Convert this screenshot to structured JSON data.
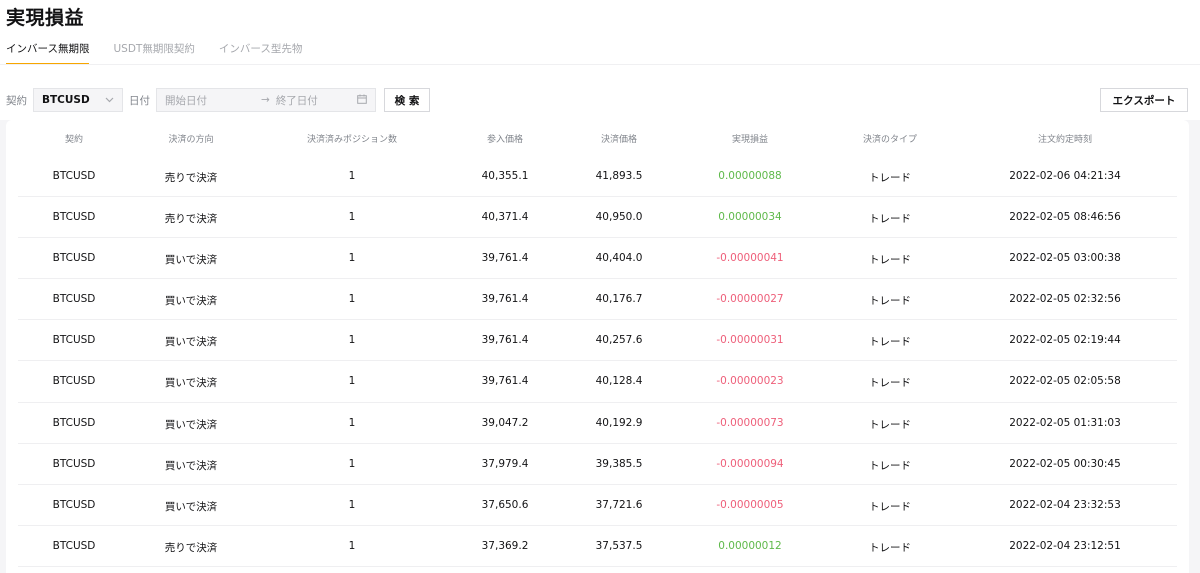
{
  "page": {
    "title": "実現損益"
  },
  "tabs": [
    {
      "label": "インバース無期限",
      "active": true
    },
    {
      "label": "USDT無期限契約",
      "active": false
    },
    {
      "label": "インバース型先物",
      "active": false
    }
  ],
  "filters": {
    "contract_label": "契約",
    "contract_value": "BTCUSD",
    "date_label": "日付",
    "start_placeholder": "開始日付",
    "end_placeholder": "終了日付",
    "search_label": "検 索",
    "export_label": "エクスポート"
  },
  "table": {
    "headers": [
      "契約",
      "決済の方向",
      "決済済みポジション数",
      "参入価格",
      "決済価格",
      "実現損益",
      "決済のタイプ",
      "注文約定時刻"
    ],
    "rows": [
      {
        "contract": "BTCUSD",
        "side": "売りで決済",
        "qty": "1",
        "entry": "40,355.1",
        "exit": "41,893.5",
        "pnl": "0.00000088",
        "type": "トレード",
        "time": "2022-02-06 04:21:34"
      },
      {
        "contract": "BTCUSD",
        "side": "売りで決済",
        "qty": "1",
        "entry": "40,371.4",
        "exit": "40,950.0",
        "pnl": "0.00000034",
        "type": "トレード",
        "time": "2022-02-05 08:46:56"
      },
      {
        "contract": "BTCUSD",
        "side": "買いで決済",
        "qty": "1",
        "entry": "39,761.4",
        "exit": "40,404.0",
        "pnl": "-0.00000041",
        "type": "トレード",
        "time": "2022-02-05 03:00:38"
      },
      {
        "contract": "BTCUSD",
        "side": "買いで決済",
        "qty": "1",
        "entry": "39,761.4",
        "exit": "40,176.7",
        "pnl": "-0.00000027",
        "type": "トレード",
        "time": "2022-02-05 02:32:56"
      },
      {
        "contract": "BTCUSD",
        "side": "買いで決済",
        "qty": "1",
        "entry": "39,761.4",
        "exit": "40,257.6",
        "pnl": "-0.00000031",
        "type": "トレード",
        "time": "2022-02-05 02:19:44"
      },
      {
        "contract": "BTCUSD",
        "side": "買いで決済",
        "qty": "1",
        "entry": "39,761.4",
        "exit": "40,128.4",
        "pnl": "-0.00000023",
        "type": "トレード",
        "time": "2022-02-05 02:05:58"
      },
      {
        "contract": "BTCUSD",
        "side": "買いで決済",
        "qty": "1",
        "entry": "39,047.2",
        "exit": "40,192.9",
        "pnl": "-0.00000073",
        "type": "トレード",
        "time": "2022-02-05 01:31:03"
      },
      {
        "contract": "BTCUSD",
        "side": "買いで決済",
        "qty": "1",
        "entry": "37,979.4",
        "exit": "39,385.5",
        "pnl": "-0.00000094",
        "type": "トレード",
        "time": "2022-02-05 00:30:45"
      },
      {
        "contract": "BTCUSD",
        "side": "買いで決済",
        "qty": "1",
        "entry": "37,650.6",
        "exit": "37,721.6",
        "pnl": "-0.00000005",
        "type": "トレード",
        "time": "2022-02-04 23:32:53"
      },
      {
        "contract": "BTCUSD",
        "side": "売りで決済",
        "qty": "1",
        "entry": "37,369.2",
        "exit": "37,537.5",
        "pnl": "0.00000012",
        "type": "トレード",
        "time": "2022-02-04 23:12:51"
      }
    ]
  },
  "colors": {
    "accent": "#f7a600",
    "profit": "#5fb94b",
    "loss": "#ee5f7a"
  },
  "icons": {
    "dropdown": "chevron-down-icon",
    "date": "calendar-icon",
    "range": "arrow-right-icon"
  }
}
